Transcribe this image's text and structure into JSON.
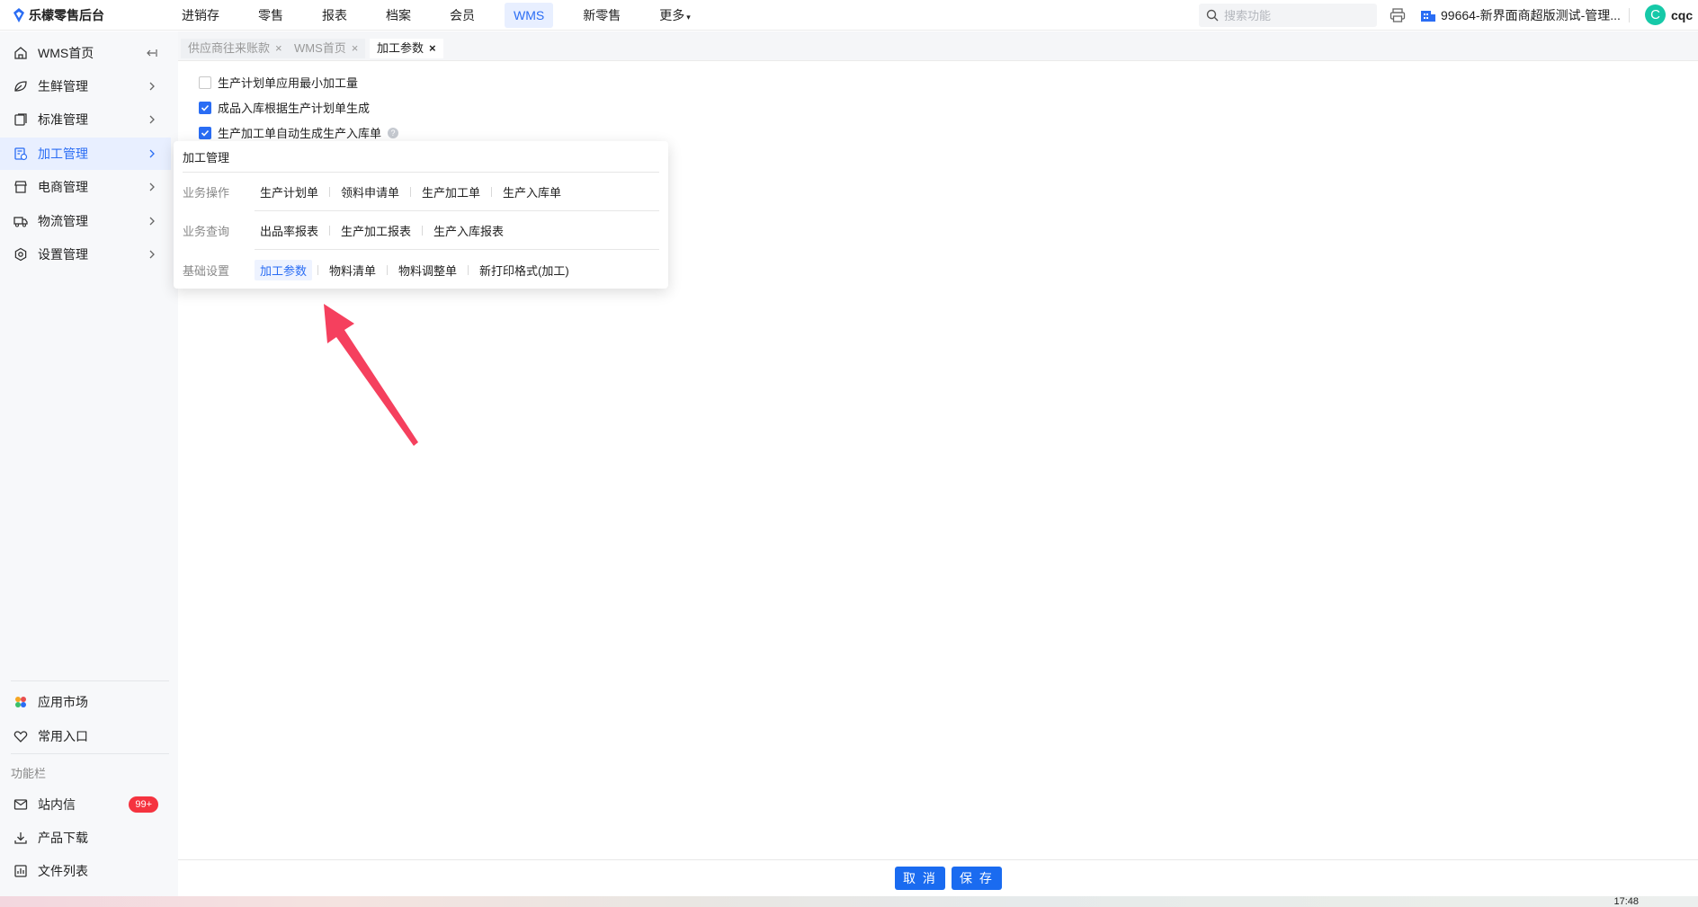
{
  "app": {
    "title": "乐檬零售后台"
  },
  "topnav": {
    "items": [
      {
        "label": "进销存"
      },
      {
        "label": "零售"
      },
      {
        "label": "报表"
      },
      {
        "label": "档案"
      },
      {
        "label": "会员"
      },
      {
        "label": "WMS"
      },
      {
        "label": "新零售"
      },
      {
        "label": "更多"
      }
    ],
    "active": "WMS",
    "search_placeholder": "搜索功能",
    "store": "99664-新界面商超版测试-管理...",
    "user_initial": "C",
    "user_name": "cqc"
  },
  "sidebar": {
    "items": [
      {
        "label": "WMS首页",
        "icon": "home-icon"
      },
      {
        "label": "生鲜管理",
        "icon": "fresh-icon"
      },
      {
        "label": "标准管理",
        "icon": "standard-icon"
      },
      {
        "label": "加工管理",
        "icon": "process-icon"
      },
      {
        "label": "电商管理",
        "icon": "shop-icon"
      },
      {
        "label": "物流管理",
        "icon": "truck-icon"
      },
      {
        "label": "设置管理",
        "icon": "settings-icon"
      }
    ],
    "active": "加工管理",
    "bottom": {
      "app_market": "应用市场",
      "favorites": "常用入口",
      "section_label": "功能栏",
      "messages": "站内信",
      "messages_badge": "99+",
      "download": "产品下载",
      "files": "文件列表"
    }
  },
  "tabs": [
    {
      "label": "供应商往来账款",
      "active": false
    },
    {
      "label": "WMS首页",
      "active": false
    },
    {
      "label": "加工参数",
      "active": true
    }
  ],
  "settings": [
    {
      "label": "生产计划单应用最小加工量",
      "checked": false
    },
    {
      "label": "成品入库根据生产计划单生成",
      "checked": true
    },
    {
      "label": "生产加工单自动生成生产入库单",
      "checked": true
    }
  ],
  "popover": {
    "title": "加工管理",
    "groups": [
      {
        "category": "业务操作",
        "links": [
          "生产计划单",
          "领料申请单",
          "生产加工单",
          "生产入库单"
        ]
      },
      {
        "category": "业务查询",
        "links": [
          "出品率报表",
          "生产加工报表",
          "生产入库报表"
        ]
      },
      {
        "category": "基础设置",
        "links": [
          "加工参数",
          "物料清单",
          "物料调整单",
          "新打印格式(加工)"
        ]
      }
    ],
    "active_link": "加工参数"
  },
  "footer": {
    "cancel": "取 消",
    "save": "保 存"
  },
  "taskbar": {
    "time": "17:48"
  },
  "colors": {
    "accent": "#2a6df4",
    "button": "#1a6bf0",
    "badge": "#f5333f",
    "arrow": "#f5405e",
    "avatar": "#16c9a8"
  }
}
